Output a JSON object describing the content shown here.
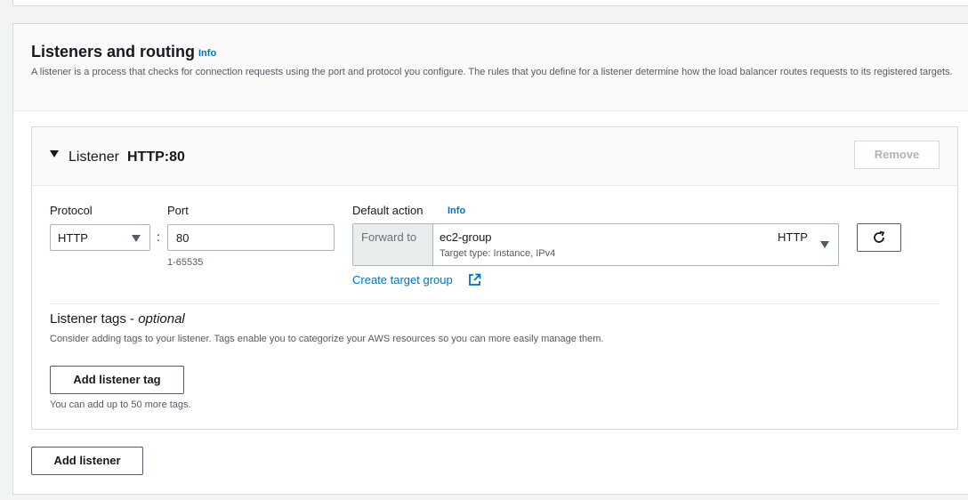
{
  "section": {
    "title": "Listeners and routing",
    "info_label": "Info",
    "description": "A listener is a process that checks for connection requests using the port and protocol you configure. The rules that you define for a listener determine how the load balancer routes requests to its registered targets."
  },
  "listener": {
    "title_prefix": "Listener",
    "title_value": "HTTP:80",
    "remove_label": "Remove",
    "protocol": {
      "label": "Protocol",
      "value": "HTTP"
    },
    "port": {
      "label": "Port",
      "value": "80",
      "hint": "1-65535"
    },
    "colon": ":",
    "default_action": {
      "label": "Default action",
      "info_label": "Info",
      "forward_label": "Forward to",
      "target_group": "ec2-group",
      "target_type": "Target type: Instance, IPv4",
      "protocol": "HTTP",
      "create_link": "Create target group"
    },
    "tags": {
      "title": "Listener tags - ",
      "title_optional": "optional",
      "description": "Consider adding tags to your listener. Tags enable you to categorize your AWS resources so you can more easily manage them.",
      "add_label": "Add listener tag",
      "hint": "You can add up to 50 more tags."
    }
  },
  "add_listener_label": "Add listener",
  "icons": {
    "collapse": "caret-down-icon",
    "dropdown": "dropdown-arrow-icon",
    "refresh": "refresh-icon",
    "external": "external-link-icon"
  },
  "colors": {
    "link": "#0073bb",
    "border": "#aab7b8",
    "text": "#16191f",
    "muted": "#545b64",
    "disabled": "#aab7b8"
  }
}
